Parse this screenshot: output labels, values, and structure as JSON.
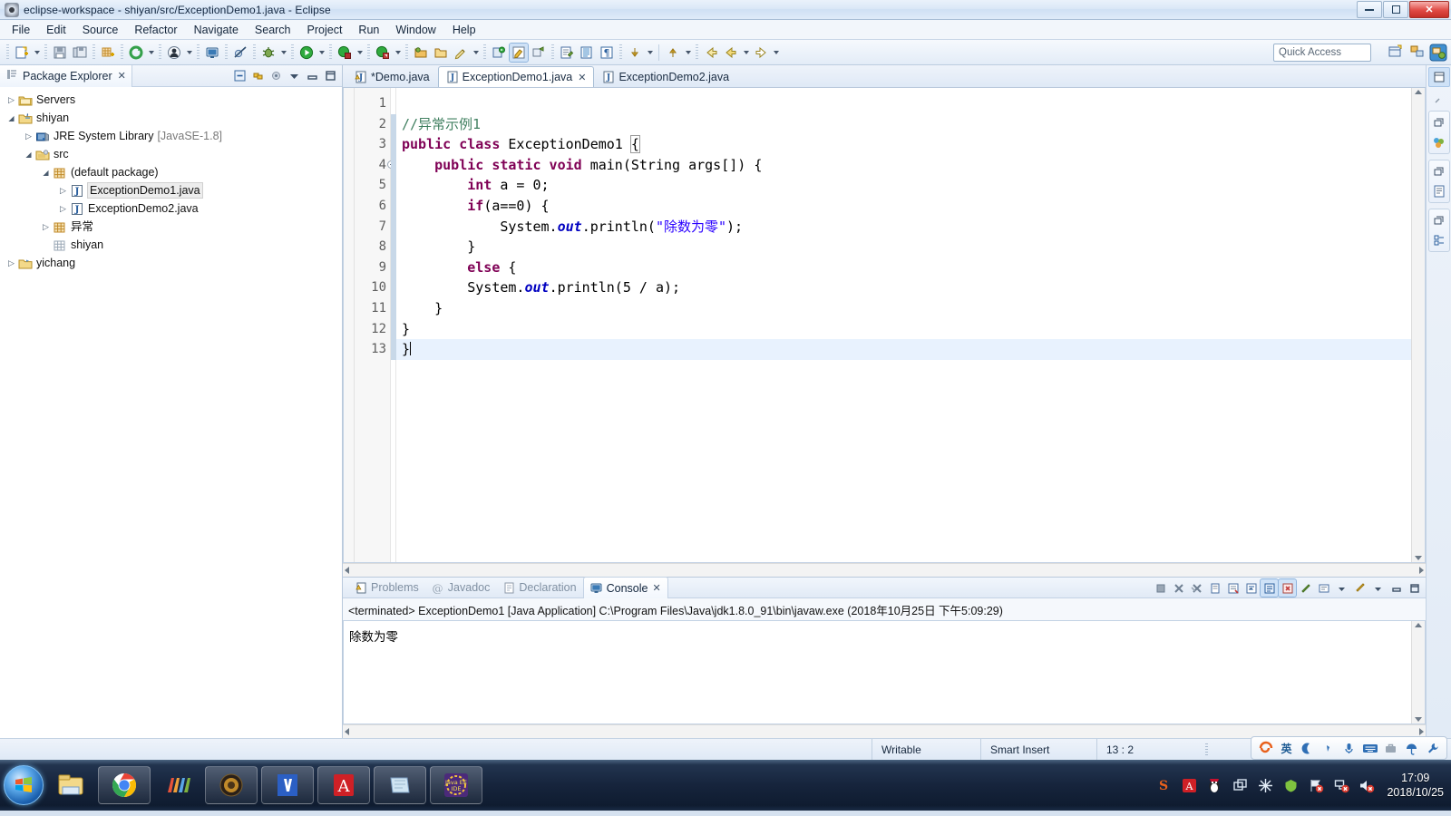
{
  "window": {
    "title": "eclipse-workspace - shiyan/src/ExceptionDemo1.java - Eclipse",
    "minimize_label": "Minimize",
    "restore_label": "Restore",
    "close_label": "Close"
  },
  "menubar": {
    "items": [
      {
        "label": "File"
      },
      {
        "label": "Edit"
      },
      {
        "label": "Source"
      },
      {
        "label": "Refactor"
      },
      {
        "label": "Navigate"
      },
      {
        "label": "Search"
      },
      {
        "label": "Project"
      },
      {
        "label": "Run"
      },
      {
        "label": "Window"
      },
      {
        "label": "Help"
      }
    ]
  },
  "toolbar": {
    "quick_access_placeholder": "Quick Access",
    "icons": [
      "new-wizard-icon",
      "save-icon",
      "save-all-icon",
      "new-java-package-icon",
      "refresh-icon",
      "run-last-tool-icon",
      "open-console-icon",
      "skip-breakpoints-icon",
      "debug-icon",
      "run-icon",
      "coverage-icon",
      "external-tools-icon",
      "new-java-project-icon",
      "open-type-icon",
      "search-icon",
      "marker-icon",
      "toggle-mark-occurrences-icon",
      "link-editor-icon",
      "open-task-icon",
      "show-whitespace-icon",
      "pilcrow-icon",
      "next-annotation-icon",
      "previous-annotation-icon",
      "back-icon",
      "forward-icon"
    ],
    "perspective_icons": [
      "open-perspective-icon",
      "java-perspective-icon",
      "java-ee-perspective-icon"
    ]
  },
  "package_explorer": {
    "tab_label": "Package Explorer",
    "close_glyph": "✕",
    "toolbar_icons": [
      "collapse-all-icon",
      "link-with-editor-icon",
      "view-menu-icon",
      "minimize-icon",
      "maximize-icon"
    ],
    "tree": [
      {
        "label": "Servers",
        "depth": 0,
        "twisty": "collapsed",
        "icon": "folder-icon",
        "dim": "",
        "selected": false
      },
      {
        "label": "shiyan",
        "depth": 0,
        "twisty": "expanded",
        "icon": "java-project-icon",
        "dim": "",
        "selected": false
      },
      {
        "label": "JRE System Library",
        "depth": 1,
        "twisty": "collapsed",
        "icon": "library-icon",
        "dim": "[JavaSE-1.8]",
        "selected": false
      },
      {
        "label": "src",
        "depth": 1,
        "twisty": "expanded",
        "icon": "source-folder-icon",
        "dim": "",
        "selected": false
      },
      {
        "label": "(default package)",
        "depth": 2,
        "twisty": "expanded",
        "icon": "package-icon",
        "dim": "",
        "selected": false
      },
      {
        "label": "ExceptionDemo1.java",
        "depth": 3,
        "twisty": "collapsed",
        "icon": "java-file-icon",
        "dim": "",
        "selected": true
      },
      {
        "label": "ExceptionDemo2.java",
        "depth": 3,
        "twisty": "collapsed",
        "icon": "java-file-icon",
        "dim": "",
        "selected": false
      },
      {
        "label": "异常",
        "depth": 2,
        "twisty": "collapsed",
        "icon": "package-icon",
        "dim": "",
        "selected": false
      },
      {
        "label": "shiyan",
        "depth": 2,
        "twisty": "none",
        "icon": "empty-package-icon",
        "dim": "",
        "selected": false
      },
      {
        "label": "yichang",
        "depth": 0,
        "twisty": "collapsed",
        "icon": "project-icon",
        "dim": "",
        "selected": false
      }
    ]
  },
  "editor": {
    "tabs": [
      {
        "label": "*Demo.java",
        "active": false,
        "dirty": true,
        "closable": false
      },
      {
        "label": "ExceptionDemo1.java",
        "active": true,
        "dirty": false,
        "closable": true
      },
      {
        "label": "ExceptionDemo2.java",
        "active": false,
        "dirty": false,
        "closable": false
      }
    ],
    "close_glyph": "✕",
    "lines": [
      {
        "n": "1",
        "folding": false,
        "changed": false,
        "current": false,
        "tokens": []
      },
      {
        "n": "2",
        "folding": false,
        "changed": true,
        "current": false,
        "tokens": [
          {
            "t": "//异常示例1",
            "c": "cm"
          }
        ]
      },
      {
        "n": "3",
        "folding": false,
        "changed": true,
        "current": false,
        "tokens": [
          {
            "t": "public class ",
            "c": "kw"
          },
          {
            "t": "ExceptionDemo1 ",
            "c": "nm"
          },
          {
            "t": "{",
            "c": "brmatch"
          }
        ]
      },
      {
        "n": "4",
        "folding": true,
        "changed": true,
        "current": false,
        "tokens": [
          {
            "t": "    ",
            "c": "nm"
          },
          {
            "t": "public static void ",
            "c": "kw"
          },
          {
            "t": "main(String args[]) {",
            "c": "nm"
          }
        ]
      },
      {
        "n": "5",
        "folding": false,
        "changed": true,
        "current": false,
        "tokens": [
          {
            "t": "        ",
            "c": "nm"
          },
          {
            "t": "int ",
            "c": "kw"
          },
          {
            "t": "a = 0;",
            "c": "nm"
          }
        ]
      },
      {
        "n": "6",
        "folding": false,
        "changed": true,
        "current": false,
        "tokens": [
          {
            "t": "        ",
            "c": "nm"
          },
          {
            "t": "if",
            "c": "kw"
          },
          {
            "t": "(a==0) {",
            "c": "nm"
          }
        ]
      },
      {
        "n": "7",
        "folding": false,
        "changed": true,
        "current": false,
        "tokens": [
          {
            "t": "            System.",
            "c": "nm"
          },
          {
            "t": "out",
            "c": "fld"
          },
          {
            "t": ".println(",
            "c": "nm"
          },
          {
            "t": "\"除数为零\"",
            "c": "st"
          },
          {
            "t": ");",
            "c": "nm"
          }
        ]
      },
      {
        "n": "8",
        "folding": false,
        "changed": true,
        "current": false,
        "tokens": [
          {
            "t": "        }",
            "c": "nm"
          }
        ]
      },
      {
        "n": "9",
        "folding": false,
        "changed": true,
        "current": false,
        "tokens": [
          {
            "t": "        ",
            "c": "nm"
          },
          {
            "t": "else",
            "c": "kw"
          },
          {
            "t": " {",
            "c": "nm"
          }
        ]
      },
      {
        "n": "10",
        "folding": false,
        "changed": true,
        "current": false,
        "tokens": [
          {
            "t": "        System.",
            "c": "nm"
          },
          {
            "t": "out",
            "c": "fld"
          },
          {
            "t": ".println(5 / a);",
            "c": "nm"
          }
        ]
      },
      {
        "n": "11",
        "folding": false,
        "changed": true,
        "current": false,
        "tokens": [
          {
            "t": "    }",
            "c": "nm"
          }
        ]
      },
      {
        "n": "12",
        "folding": false,
        "changed": true,
        "current": false,
        "tokens": [
          {
            "t": "}",
            "c": "nm"
          }
        ]
      },
      {
        "n": "13",
        "folding": false,
        "changed": true,
        "current": true,
        "tokens": [
          {
            "t": "}",
            "c": "nm"
          }
        ]
      }
    ]
  },
  "console": {
    "tabs": [
      {
        "label": "Problems",
        "icon": "problems-icon",
        "active": false,
        "closable": false
      },
      {
        "label": "Javadoc",
        "icon": "javadoc-icon",
        "active": false,
        "closable": false
      },
      {
        "label": "Declaration",
        "icon": "declaration-icon",
        "active": false,
        "closable": false
      },
      {
        "label": "Console",
        "icon": "console-icon",
        "active": true,
        "closable": true
      }
    ],
    "close_glyph": "✕",
    "toolbar_icons": [
      "terminate-icon",
      "remove-launch-icon",
      "remove-all-terminated-icon",
      "clear-console-icon",
      "scroll-lock-icon",
      "word-wrap-icon",
      "show-console-on-output-icon",
      "show-console-on-error-icon",
      "pin-console-icon",
      "display-selected-console-icon",
      "open-console-icon",
      "minimize-icon",
      "maximize-icon"
    ],
    "launch_line": "<terminated> ExceptionDemo1 [Java Application] C:\\Program Files\\Java\\jdk1.8.0_91\\bin\\javaw.exe (2018年10月25日 下午5:09:29)",
    "output": "除数为零"
  },
  "statusbar": {
    "writable": "Writable",
    "insert_mode": "Smart Insert",
    "position": "13 : 2"
  },
  "right_bar": {
    "icons": [
      "restore-icon",
      "outline-icon",
      "restore-icon",
      "task-list-icon",
      "restore-icon",
      "properties-icon"
    ],
    "active_tab_icon": "editor-area-icon"
  },
  "taskbar": {
    "start_label": "Start",
    "buttons": [
      {
        "name": "windows-explorer-icon"
      },
      {
        "name": "google-chrome-icon"
      },
      {
        "name": "wps-office-icon"
      },
      {
        "name": "firefox-like-icon"
      },
      {
        "name": "word-icon"
      },
      {
        "name": "adobe-reader-icon"
      },
      {
        "name": "notebook-icon"
      },
      {
        "name": "eclipse-javaee-icon"
      }
    ],
    "tray_icons": [
      "sogou-pinyin-icon",
      "adobe-icon",
      "qq-penguin-icon",
      "window-stack-icon",
      "snowflake-icon",
      "green-shield-icon",
      "flag-error-icon",
      "network-error-icon",
      "volume-mute-icon"
    ],
    "ime_icons": [
      "sogou-logo-icon",
      "chinese-mode-icon",
      "moon-icon",
      "comma-icon",
      "mic-icon",
      "keyboard-icon",
      "toolbox-icon",
      "umbrella-icon",
      "wrench-icon"
    ],
    "ime_mode": "英",
    "clock_time": "17:09",
    "clock_date": "2018/10/25"
  },
  "colors": {
    "keyword": "#7f0055",
    "comment": "#3f7f5f",
    "string": "#2a00ff",
    "field": "#0000c0",
    "current_line": "#e8f2fe",
    "selection": "#cfe2f7",
    "chrome": "#e3ecf7"
  }
}
